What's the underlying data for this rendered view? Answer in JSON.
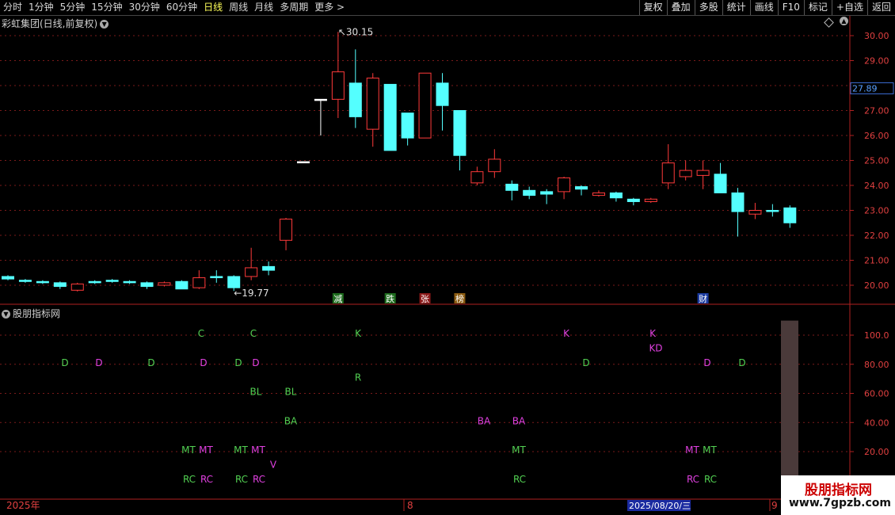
{
  "toolbar": {
    "periods": [
      "分时",
      "1分钟",
      "5分钟",
      "15分钟",
      "30分钟",
      "60分钟",
      "日线",
      "周线",
      "月线",
      "多周期",
      "更多 >"
    ],
    "active_period": "日线",
    "actions": [
      "复权",
      "叠加",
      "多股",
      "统计",
      "画线",
      "F10",
      "标记",
      "+自选",
      "返回"
    ]
  },
  "main_chart": {
    "title": "彩虹集团(日线,前复权)",
    "price_ticks": [
      "30.00",
      "29.00",
      "28.00",
      "27.00",
      "26.00",
      "25.00",
      "24.00",
      "23.00",
      "22.00",
      "21.00",
      "20.00"
    ],
    "current_price_label": "27.89",
    "high_label": "30.15",
    "low_label": "19.77"
  },
  "chart_data": {
    "type": "candlestick",
    "y_range": [
      19.5,
      30.5
    ],
    "candles": [
      {
        "o": 20.25,
        "c": 20.35,
        "h": 20.4,
        "l": 20.2,
        "dir": "down"
      },
      {
        "o": 20.2,
        "c": 20.15,
        "h": 20.25,
        "l": 20.1,
        "dir": "down"
      },
      {
        "o": 20.15,
        "c": 20.1,
        "h": 20.2,
        "l": 20.05,
        "dir": "down"
      },
      {
        "o": 20.1,
        "c": 19.95,
        "h": 20.15,
        "l": 19.85,
        "dir": "down"
      },
      {
        "o": 19.8,
        "c": 20.05,
        "h": 20.1,
        "l": 19.75,
        "dir": "up"
      },
      {
        "o": 20.1,
        "c": 20.15,
        "h": 20.2,
        "l": 20.05,
        "dir": "down"
      },
      {
        "o": 20.15,
        "c": 20.2,
        "h": 20.25,
        "l": 20.1,
        "dir": "down"
      },
      {
        "o": 20.15,
        "c": 20.1,
        "h": 20.2,
        "l": 20.05,
        "dir": "down"
      },
      {
        "o": 20.1,
        "c": 19.95,
        "h": 20.15,
        "l": 19.85,
        "dir": "down"
      },
      {
        "o": 20.0,
        "c": 20.1,
        "h": 20.15,
        "l": 19.95,
        "dir": "up"
      },
      {
        "o": 20.15,
        "c": 19.85,
        "h": 20.2,
        "l": 19.85,
        "dir": "down"
      },
      {
        "o": 19.9,
        "c": 20.3,
        "h": 20.6,
        "l": 19.85,
        "dir": "up"
      },
      {
        "o": 20.35,
        "c": 20.3,
        "h": 20.6,
        "l": 20.1,
        "dir": "down"
      },
      {
        "o": 20.35,
        "c": 19.9,
        "h": 20.4,
        "l": 19.77,
        "dir": "down"
      },
      {
        "o": 20.35,
        "c": 20.7,
        "h": 21.5,
        "l": 20.2,
        "dir": "up"
      },
      {
        "o": 20.75,
        "c": 20.6,
        "h": 20.95,
        "l": 20.4,
        "dir": "down"
      },
      {
        "o": 21.8,
        "c": 22.65,
        "h": 22.7,
        "l": 21.4,
        "dir": "up"
      },
      {
        "o": 24.95,
        "c": 24.95,
        "h": 24.95,
        "l": 24.95,
        "dir": "flat"
      },
      {
        "o": 27.45,
        "c": 27.45,
        "h": 27.45,
        "l": 26.0,
        "dir": "flat_white"
      },
      {
        "o": 27.45,
        "c": 28.55,
        "h": 30.15,
        "l": 26.7,
        "dir": "up"
      },
      {
        "o": 28.1,
        "c": 26.75,
        "h": 29.45,
        "l": 26.3,
        "dir": "down"
      },
      {
        "o": 26.25,
        "c": 28.3,
        "h": 28.5,
        "l": 25.55,
        "dir": "up"
      },
      {
        "o": 28.05,
        "c": 25.4,
        "h": 28.05,
        "l": 25.4,
        "dir": "down"
      },
      {
        "o": 26.9,
        "c": 25.9,
        "h": 26.9,
        "l": 25.6,
        "dir": "down"
      },
      {
        "o": 25.9,
        "c": 28.5,
        "h": 28.5,
        "l": 25.9,
        "dir": "up"
      },
      {
        "o": 28.1,
        "c": 27.2,
        "h": 28.5,
        "l": 26.2,
        "dir": "down"
      },
      {
        "o": 27.0,
        "c": 25.2,
        "h": 27.0,
        "l": 24.6,
        "dir": "down"
      },
      {
        "o": 24.1,
        "c": 24.55,
        "h": 24.75,
        "l": 24.0,
        "dir": "up"
      },
      {
        "o": 24.55,
        "c": 25.05,
        "h": 25.45,
        "l": 24.3,
        "dir": "up"
      },
      {
        "o": 24.05,
        "c": 23.8,
        "h": 24.2,
        "l": 23.4,
        "dir": "down"
      },
      {
        "o": 23.8,
        "c": 23.6,
        "h": 23.95,
        "l": 23.45,
        "dir": "down"
      },
      {
        "o": 23.75,
        "c": 23.65,
        "h": 23.85,
        "l": 23.25,
        "dir": "down"
      },
      {
        "o": 23.75,
        "c": 24.3,
        "h": 24.35,
        "l": 23.45,
        "dir": "up"
      },
      {
        "o": 23.95,
        "c": 23.85,
        "h": 24.0,
        "l": 23.6,
        "dir": "down"
      },
      {
        "o": 23.6,
        "c": 23.7,
        "h": 23.8,
        "l": 23.55,
        "dir": "up"
      },
      {
        "o": 23.7,
        "c": 23.5,
        "h": 23.75,
        "l": 23.35,
        "dir": "down"
      },
      {
        "o": 23.45,
        "c": 23.35,
        "h": 23.5,
        "l": 23.2,
        "dir": "down"
      },
      {
        "o": 23.35,
        "c": 23.45,
        "h": 23.5,
        "l": 23.3,
        "dir": "up"
      },
      {
        "o": 24.1,
        "c": 24.9,
        "h": 25.65,
        "l": 23.85,
        "dir": "up"
      },
      {
        "o": 24.35,
        "c": 24.6,
        "h": 25.0,
        "l": 24.2,
        "dir": "up"
      },
      {
        "o": 24.4,
        "c": 24.6,
        "h": 25.0,
        "l": 23.85,
        "dir": "up"
      },
      {
        "o": 24.45,
        "c": 23.7,
        "h": 24.9,
        "l": 23.7,
        "dir": "down"
      },
      {
        "o": 23.7,
        "c": 22.95,
        "h": 23.9,
        "l": 21.95,
        "dir": "down"
      },
      {
        "o": 22.85,
        "c": 23.0,
        "h": 23.3,
        "l": 22.65,
        "dir": "up"
      },
      {
        "o": 23.0,
        "c": 23.0,
        "h": 23.25,
        "l": 22.75,
        "dir": "flat_cyan"
      },
      {
        "o": 23.1,
        "c": 22.5,
        "h": 23.2,
        "l": 22.3,
        "dir": "down"
      }
    ],
    "event_tags": [
      {
        "label": "减",
        "bg": "#1d6b1d",
        "i": 19
      },
      {
        "label": "跌",
        "bg": "#1d6b1d",
        "i": 22
      },
      {
        "label": "张",
        "bg": "#8b1a1a",
        "i": 24
      },
      {
        "label": "榜",
        "bg": "#8a5a10",
        "i": 26
      },
      {
        "label": "财",
        "bg": "#1a3aa0",
        "i": 40
      }
    ],
    "indicator": {
      "name": "股朋指标网",
      "y_ticks": [
        "100.0",
        "80.00",
        "60.00",
        "40.00",
        "20.00"
      ],
      "y_range": [
        0,
        120
      ],
      "labels": [
        {
          "t": "C",
          "c": "#52d052",
          "x": 254,
          "v": 101
        },
        {
          "t": "C",
          "c": "#52d052",
          "x": 320,
          "v": 101
        },
        {
          "t": "K",
          "c": "#52d052",
          "x": 452,
          "v": 101
        },
        {
          "t": "K",
          "c": "#e040e0",
          "x": 715,
          "v": 101
        },
        {
          "t": "K",
          "c": "#e040e0",
          "x": 824,
          "v": 101
        },
        {
          "t": "KD",
          "c": "#e040e0",
          "x": 828,
          "v": 91
        },
        {
          "t": "D",
          "c": "#52d052",
          "x": 82,
          "v": 81
        },
        {
          "t": "D",
          "c": "#e040e0",
          "x": 125,
          "v": 81
        },
        {
          "t": "D",
          "c": "#52d052",
          "x": 191,
          "v": 81
        },
        {
          "t": "D",
          "c": "#e040e0",
          "x": 257,
          "v": 81
        },
        {
          "t": "D",
          "c": "#52d052",
          "x": 301,
          "v": 81
        },
        {
          "t": "D",
          "c": "#e040e0",
          "x": 323,
          "v": 81
        },
        {
          "t": "D",
          "c": "#52d052",
          "x": 740,
          "v": 81
        },
        {
          "t": "D",
          "c": "#e040e0",
          "x": 893,
          "v": 81
        },
        {
          "t": "D",
          "c": "#52d052",
          "x": 937,
          "v": 81
        },
        {
          "t": "R",
          "c": "#52d052",
          "x": 452,
          "v": 71
        },
        {
          "t": "BL",
          "c": "#52d052",
          "x": 323,
          "v": 61
        },
        {
          "t": "BL",
          "c": "#52d052",
          "x": 367,
          "v": 61
        },
        {
          "t": "BA",
          "c": "#52d052",
          "x": 367,
          "v": 41
        },
        {
          "t": "BA",
          "c": "#e040e0",
          "x": 611,
          "v": 41
        },
        {
          "t": "BA",
          "c": "#e040e0",
          "x": 655,
          "v": 41
        },
        {
          "t": "MT",
          "c": "#52d052",
          "x": 238,
          "v": 21
        },
        {
          "t": "MT",
          "c": "#e040e0",
          "x": 260,
          "v": 21
        },
        {
          "t": "MT",
          "c": "#52d052",
          "x": 304,
          "v": 21
        },
        {
          "t": "MT",
          "c": "#e040e0",
          "x": 326,
          "v": 21
        },
        {
          "t": "MT",
          "c": "#52d052",
          "x": 655,
          "v": 21
        },
        {
          "t": "MT",
          "c": "#e040e0",
          "x": 874,
          "v": 21
        },
        {
          "t": "MT",
          "c": "#52d052",
          "x": 896,
          "v": 21
        },
        {
          "t": "V",
          "c": "#e040e0",
          "x": 345,
          "v": 11
        },
        {
          "t": "RC",
          "c": "#52d052",
          "x": 239,
          "v": 1
        },
        {
          "t": "RC",
          "c": "#e040e0",
          "x": 261,
          "v": 1
        },
        {
          "t": "RC",
          "c": "#52d052",
          "x": 305,
          "v": 1
        },
        {
          "t": "RC",
          "c": "#e040e0",
          "x": 327,
          "v": 1
        },
        {
          "t": "RC",
          "c": "#52d052",
          "x": 656,
          "v": 1
        },
        {
          "t": "RC",
          "c": "#e040e0",
          "x": 875,
          "v": 1
        },
        {
          "t": "RC",
          "c": "#52d052",
          "x": 897,
          "v": 1
        }
      ],
      "bar_value": 110
    }
  },
  "time_axis": {
    "labels": [
      "2025年",
      "8",
      "9"
    ],
    "cursor_date": "2025/08/20/三"
  },
  "watermark": {
    "line1": "股朋指标网",
    "line2": "www.7gpzb.com"
  },
  "colors": {
    "up": "#ff3a3a",
    "down": "#54ffff",
    "grid": "#7a1a1a",
    "axis": "#b02020",
    "tick_text": "#e04040"
  }
}
